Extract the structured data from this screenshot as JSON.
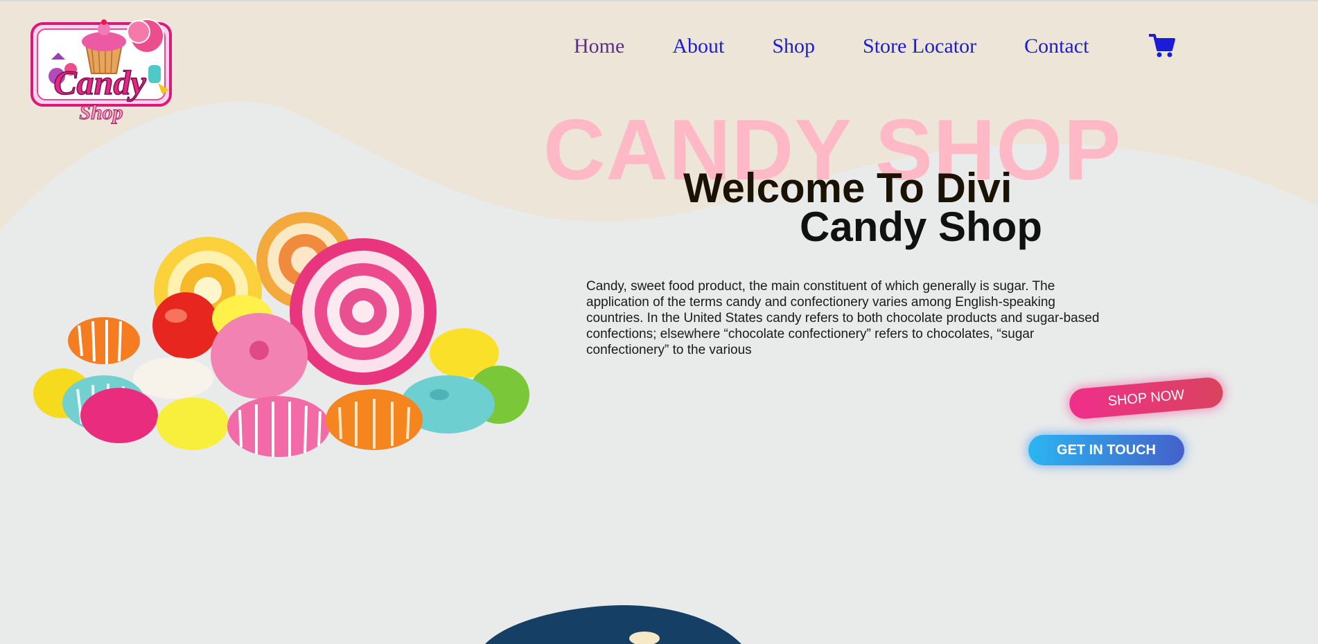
{
  "logo": {
    "line1": "Candy",
    "line2": "Shop"
  },
  "nav": {
    "items": [
      {
        "label": "Home",
        "color": "#5b2d8e"
      },
      {
        "label": "About",
        "color": "#1b1bd8"
      },
      {
        "label": "Shop",
        "color": "#1b1bd8"
      },
      {
        "label": "Store Locator",
        "color": "#1b1bd8"
      },
      {
        "label": "Contact",
        "color": "#1b1bd8"
      }
    ],
    "cart_icon": "shopping-cart-icon",
    "cart_color": "#1b1bd8"
  },
  "hero": {
    "big_title": "CANDY SHOP",
    "big_title_color": "#ffb8c6",
    "welcome_line1": "Welcome To Divi",
    "welcome_line2": "Candy Shop",
    "description": "Candy, sweet food product, the main constituent of which generally is sugar. The application of the terms candy and confectionery varies among English-speaking countries. In the United States candy refers to both chocolate products and sugar-based confections; elsewhere “chocolate confectionery” refers to chocolates, “sugar confectionery” to the various",
    "shop_button": "SHOP NOW",
    "touch_button": "GET IN TOUCH"
  },
  "colors": {
    "background": "#e9eaea",
    "wave": "#ece5d8",
    "shop_gradient": [
      "#ef2f8b",
      "#d9435e"
    ],
    "touch_gradient": [
      "#2bb5f2",
      "#4461c9"
    ],
    "bottom_oval": "#163f66"
  }
}
